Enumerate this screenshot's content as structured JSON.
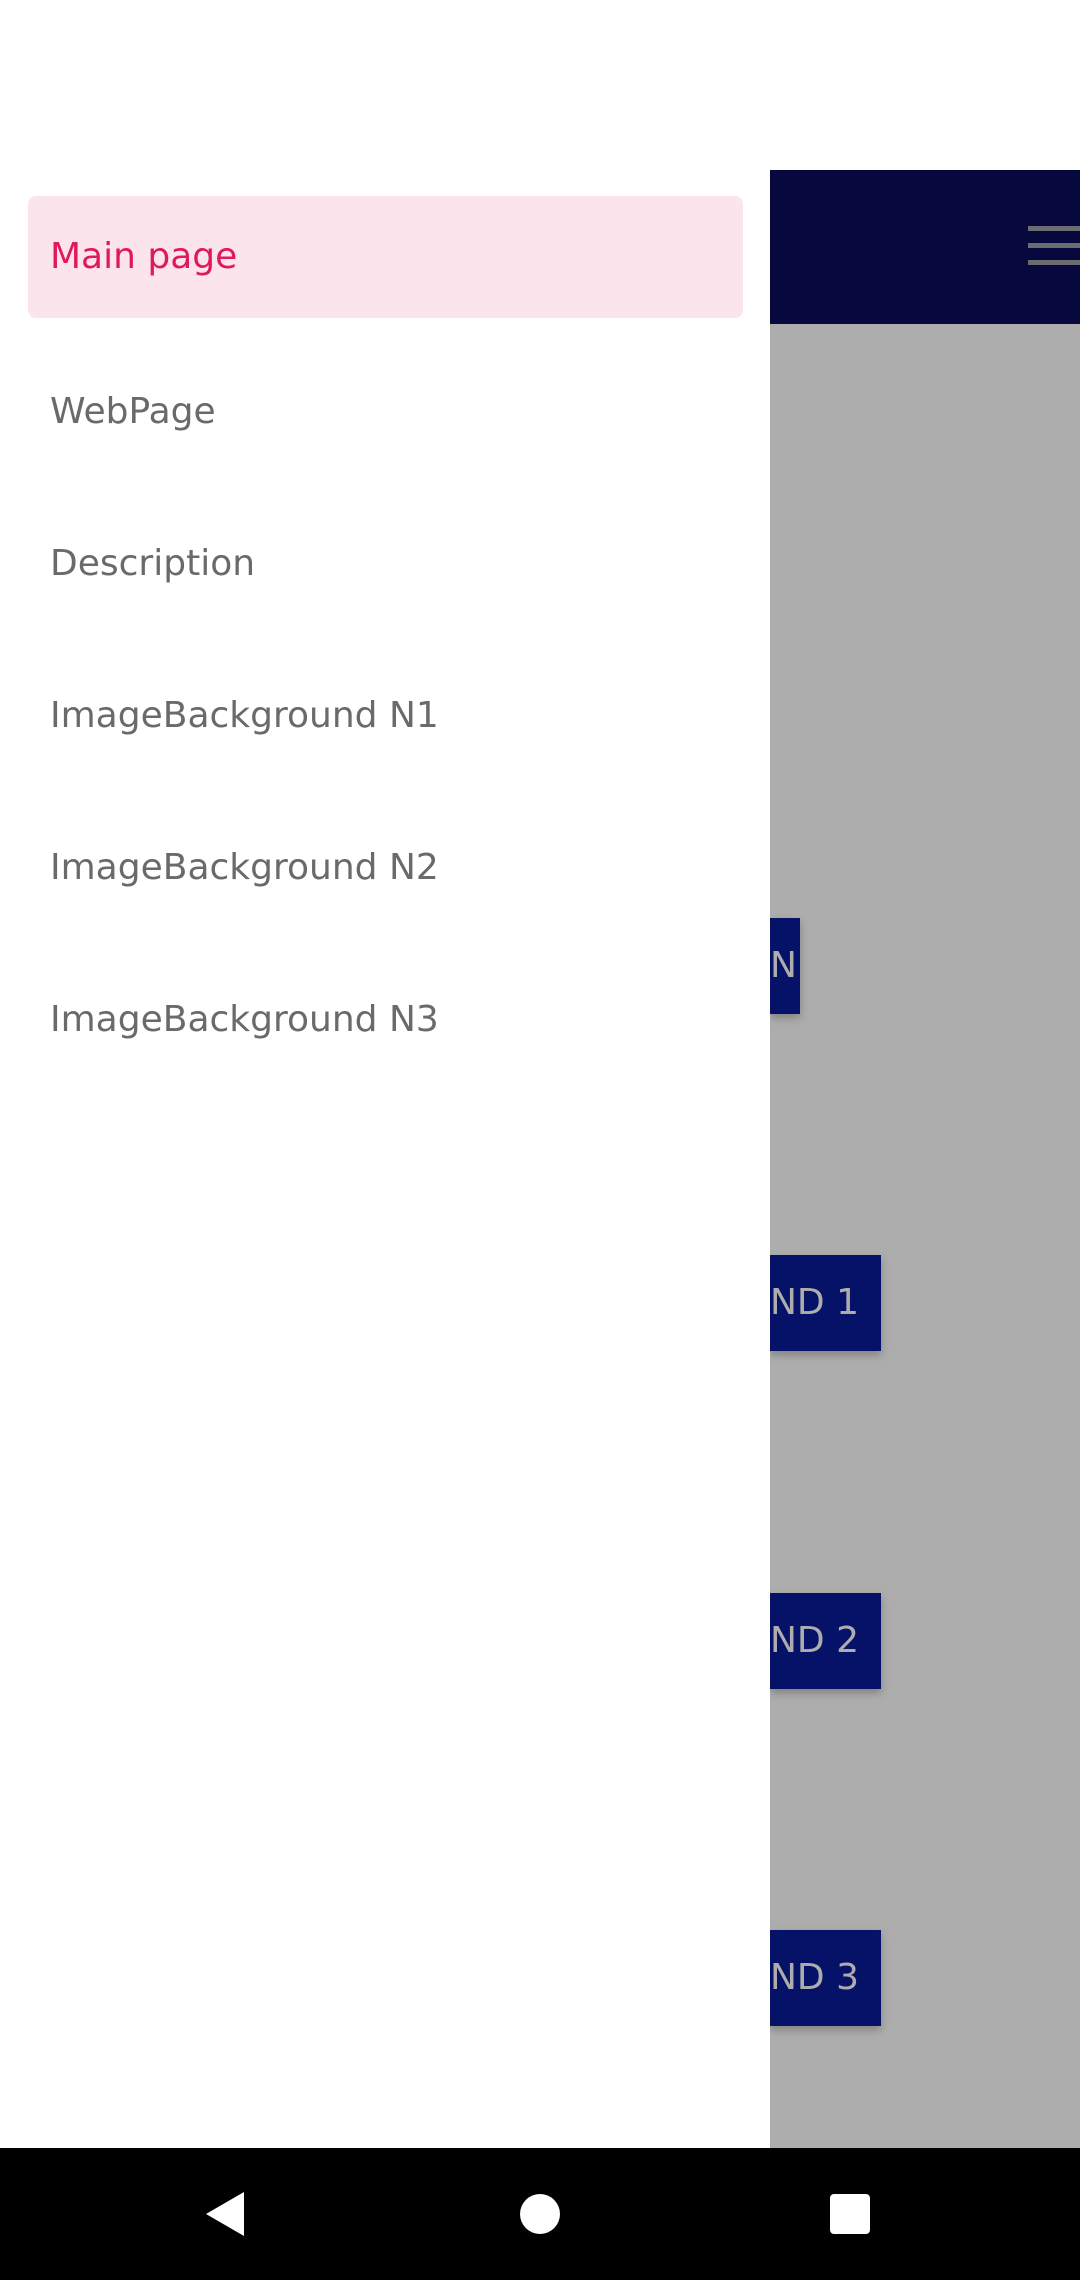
{
  "drawer": {
    "items": [
      {
        "label": "Main page",
        "active": true
      },
      {
        "label": "WebPage",
        "active": false
      },
      {
        "label": "Description",
        "active": false
      },
      {
        "label": "ImageBackground N1",
        "active": false
      },
      {
        "label": "ImageBackground N2",
        "active": false
      },
      {
        "label": "ImageBackground N3",
        "active": false
      }
    ]
  },
  "app": {
    "buttons": [
      {
        "visible_text": "N"
      },
      {
        "visible_text": "ND 1"
      },
      {
        "visible_text": "ND 2"
      },
      {
        "visible_text": "ND 3"
      }
    ]
  },
  "nav_bar": {
    "icons": [
      "back-icon",
      "home-icon",
      "recents-icon"
    ]
  },
  "colors": {
    "toolbar": "#0a0d5c",
    "app_button": "#0a1a9a",
    "active_item_bg": "#fbe4ec",
    "active_item_text": "#e0195a",
    "item_text": "#6a6a6a"
  }
}
